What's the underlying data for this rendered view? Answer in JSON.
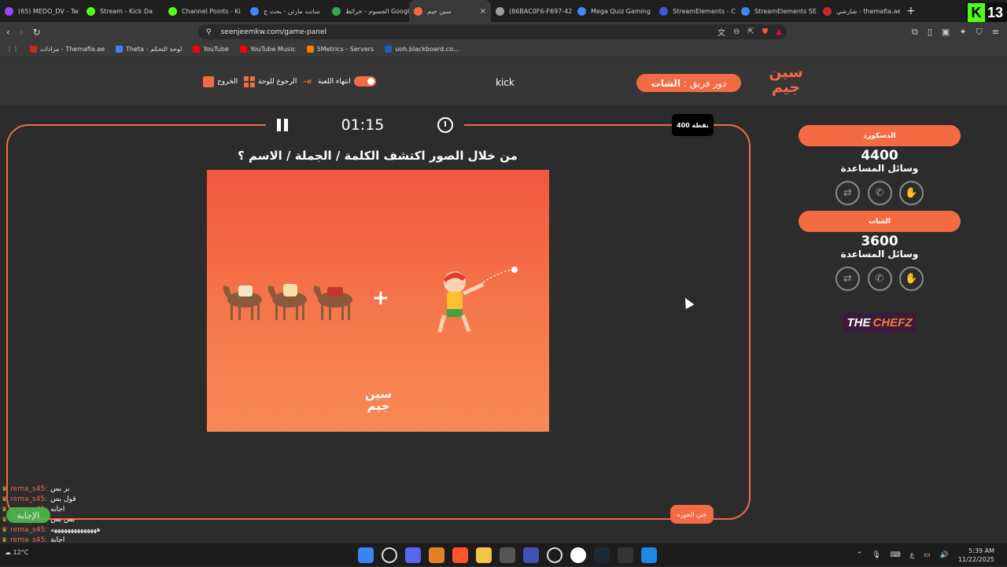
{
  "browser": {
    "tabs": [
      {
        "label": "(65) MEDO_DV - Tw",
        "color": "#9146ff"
      },
      {
        "label": "Stream - Kick Da",
        "color": "#53fc18"
      },
      {
        "label": "Channel Points - Ki",
        "color": "#53fc18"
      },
      {
        "label": "سانت مارتن - بحث ج",
        "color": "#4285f4"
      },
      {
        "label": "الجسوم - خرائط Google",
        "color": "#34a853"
      },
      {
        "label": "سين جيم",
        "color": "#f26b43",
        "active": true
      },
      {
        "label": "(86BAC0F6-F697-42",
        "color": "#9e9e9e"
      },
      {
        "label": "Mega Quiz Gaming",
        "color": "#4285f4"
      },
      {
        "label": "StreamElements - C",
        "color": "#3b5bdb"
      },
      {
        "label": "StreamElements SE",
        "color": "#4285f4"
      },
      {
        "label": "شارشي - themafia.ae",
        "color": "#c62828"
      }
    ],
    "new_tab": "+",
    "url": "seenjeemkw.com/game-panel",
    "bookmarks": [
      {
        "label": "مزادات - Themafia.ae",
        "color": "#c62828"
      },
      {
        "label": "Theta - لوحة التحكم",
        "color": "#3b82f6"
      },
      {
        "label": "YouTube",
        "color": "#ff0000"
      },
      {
        "label": "YouTube Music",
        "color": "#ff0000"
      },
      {
        "label": "5Metrics - Servers",
        "color": "#f57c00"
      },
      {
        "label": "uoh.blackboard.co...",
        "color": "#1565c0"
      }
    ],
    "kick_badge": {
      "letter": "K",
      "number": "13"
    }
  },
  "game": {
    "logo_line1": "سين",
    "logo_line2": "جيم",
    "turn_label": "دور فريق :",
    "turn_team": "الشات",
    "streamer": "kick",
    "controls": {
      "end_game": "انتهاء اللعبة",
      "back_to_board": "الرجوع للوحة",
      "exit": "الخروج"
    },
    "timer": "01:15",
    "points": "400 نقطة",
    "question": "من خلال الصور اكتشف الكلمة / الجملة / الاسم ؟",
    "plus_sign": "+",
    "answer_button": "ختن الخوره",
    "teams": [
      {
        "name": "الدسكورد",
        "score": "4400",
        "aids_label": "وسائل المساعدة"
      },
      {
        "name": "الشات",
        "score": "3600",
        "aids_label": "وسائل المساعدة"
      }
    ],
    "aid_icons": [
      "swap-icon",
      "phone-icon",
      "hand-icon"
    ],
    "sponsor": {
      "part1": "THE",
      "part2": "CHEFZ"
    }
  },
  "chat": {
    "lines": [
      {
        "user": "rema_s45:",
        "msg": "بز بس"
      },
      {
        "user": "rema_s45:",
        "msg": "قول بس"
      },
      {
        "user": "rema_s45:",
        "msg": "اجابه"
      },
      {
        "user": "rema_s45:",
        "msg": "بس بس"
      },
      {
        "user": "rema_s45:",
        "msg": "ههههههههههههههه"
      },
      {
        "user": "rema_s45:",
        "msg": "اجابة"
      }
    ],
    "answer_overlay": "الإجابة"
  },
  "taskbar": {
    "weather": "12°C",
    "time": "5:39 AM",
    "date": "11/22/2025",
    "lang": "ع"
  }
}
